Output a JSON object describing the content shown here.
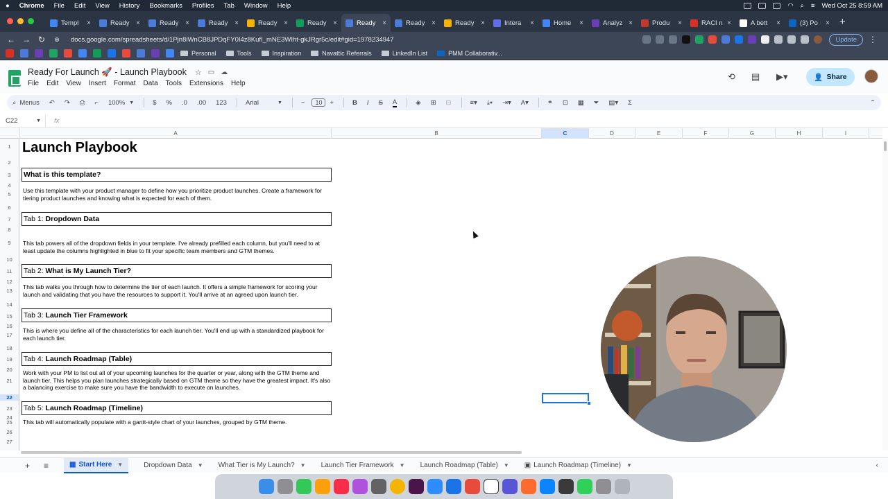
{
  "macbar": {
    "menu": [
      "Chrome",
      "File",
      "Edit",
      "View",
      "History",
      "Bookmarks",
      "Profiles",
      "Tab",
      "Window",
      "Help"
    ],
    "datetime": "Wed Oct 25  8:59 AM"
  },
  "browser": {
    "tabs": [
      {
        "label": "Templ",
        "color": "#4285f4"
      },
      {
        "label": "Ready",
        "color": "#4a7bd8"
      },
      {
        "label": "Ready",
        "color": "#4a7bd8"
      },
      {
        "label": "Ready",
        "color": "#4a7bd8"
      },
      {
        "label": "Ready",
        "color": "#f4b400"
      },
      {
        "label": "Ready",
        "color": "#0f9d58"
      },
      {
        "label": "Ready",
        "color": "#4a7bd8",
        "active": true
      },
      {
        "label": "Ready",
        "color": "#4a7bd8"
      },
      {
        "label": "Ready",
        "color": "#f4b400"
      },
      {
        "label": "Intera",
        "color": "#5f6ee8"
      },
      {
        "label": "Home",
        "color": "#4285f4"
      },
      {
        "label": "Analyz",
        "color": "#6a3fb5"
      },
      {
        "label": "Produ",
        "color": "#c0392b"
      },
      {
        "label": "RACI n",
        "color": "#d93025"
      },
      {
        "label": "A bett",
        "color": "#ffffff"
      },
      {
        "label": "(3) Po",
        "color": "#0a66c2"
      }
    ],
    "url": "docs.google.com/spreadsheets/d/1Pjn8iWnCB8JPDqFY0I4z8KufI_mNE3WIht-gkJRgr5c/edit#gid=1978234947",
    "update_label": "Update",
    "bookmarks": [
      "Personal",
      "Tools",
      "Inspiration",
      "Navattic Referrals",
      "LinkedIn List",
      "PMM Collaborativ..."
    ]
  },
  "sheets": {
    "doc_title": "Ready For Launch 🚀 - Launch Playbook",
    "menus": [
      "File",
      "Edit",
      "View",
      "Insert",
      "Format",
      "Data",
      "Tools",
      "Extensions",
      "Help"
    ],
    "share_label": "Share",
    "toolbar": {
      "menus_label": "Menus",
      "zoom": "100%",
      "currency": "$",
      "percent": "%",
      "dec_dec": ".0",
      "dec_inc": ".00",
      "number_fmt": "123",
      "font": "Arial",
      "font_size": "10",
      "bold": "B",
      "italic": "I"
    },
    "name_box": "C22",
    "fx": "fx",
    "columns": [
      "A",
      "B",
      "C",
      "D",
      "E",
      "F",
      "G",
      "H",
      "I"
    ],
    "rows": [
      "1",
      "2",
      "3",
      "4",
      "5",
      "6",
      "7",
      "8",
      "9",
      "10",
      "11",
      "12",
      "13",
      "14",
      "15",
      "16",
      "17",
      "18",
      "19",
      "20",
      "21",
      "22",
      "23",
      "24",
      "25",
      "26",
      "27"
    ],
    "selected_cell": "C22"
  },
  "content": {
    "title": "Launch Playbook",
    "sections": [
      {
        "prefix": "What is this template?",
        "bold": "",
        "body": "Use this template with your product manager to define how you prioritize product launches. Create a framework for tiering product launches and knowing what is expected for each of them."
      },
      {
        "prefix": "Tab 1: ",
        "bold": "Dropdown Data",
        "body": "This tab powers all of the dropdown fields in your template. I've already prefilled each column, but you'll need to at least update the columns highlighted in blue to fit your specific team members and GTM themes."
      },
      {
        "prefix": "Tab 2: ",
        "bold": "What is My Launch Tier?",
        "body": "This tab walks you through how to determine the tier of each launch. It offers a simple framework for scoring your launch and validating that you have the resources to support it. You'll arrive at an agreed upon launch tier."
      },
      {
        "prefix": "Tab 3: ",
        "bold": "Launch Tier Framework",
        "body": "This is where you define all of the characteristics for each launch tier. You'll end up with a standardized playbook for each launch tier."
      },
      {
        "prefix": "Tab 4: ",
        "bold": "Launch Roadmap (Table)",
        "body": "Work with your PM to list out all of your upcoming launches for the quarter or year, along with the GTM theme and launch tier. This helps you plan launches strategically based on GTM theme so they have the greatest impact. It's also a balancing exercise to make sure you have the bandwidth to execute on launches."
      },
      {
        "prefix": "Tab 5: ",
        "bold": "Launch Roadmap (Timeline)",
        "body": "This tab will automatically populate with a gantt-style chart of your launches, grouped by GTM theme."
      }
    ]
  },
  "sheet_tabs": [
    "Start Here",
    "Dropdown Data",
    "What Tier is My Launch?",
    "Launch Tier Framework",
    "Launch Roadmap (Table)",
    "Launch Roadmap (Timeline)"
  ]
}
